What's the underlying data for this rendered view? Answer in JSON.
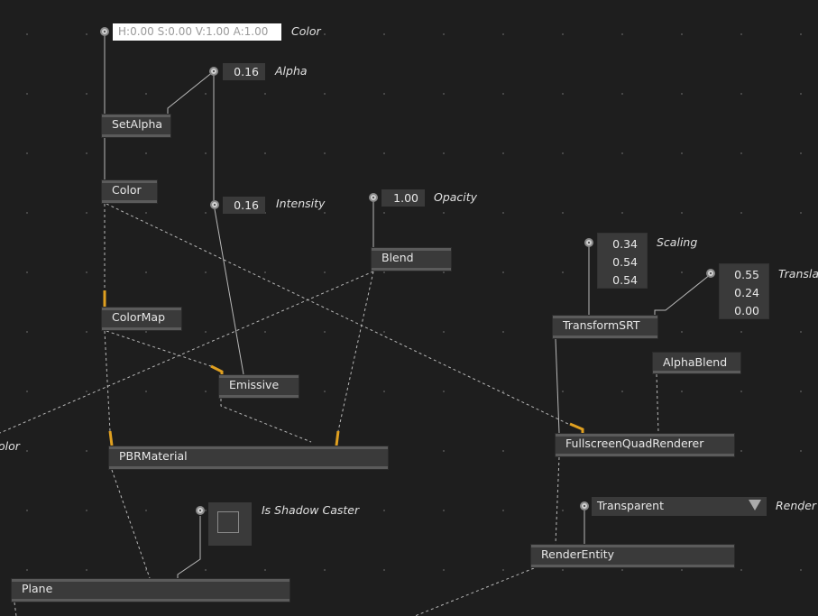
{
  "params": {
    "color": {
      "value": "H:0.00 S:0.00 V:1.00 A:1.00",
      "label": "Color"
    },
    "alpha": {
      "value": "0.16",
      "label": "Alpha"
    },
    "intensity": {
      "value": "0.16",
      "label": "Intensity"
    },
    "opacity": {
      "value": "1.00",
      "label": "Opacity"
    },
    "scaling": {
      "values": [
        "0.34",
        "0.54",
        "0.54"
      ],
      "label": "Scaling"
    },
    "translation": {
      "values": [
        "0.55",
        "0.24",
        "0.00"
      ],
      "label": "Transla"
    },
    "shadow": {
      "label": "Is Shadow Caster"
    },
    "render": {
      "value": "Transparent",
      "label": "Render"
    },
    "left_cut_label": "olor"
  },
  "nodes": {
    "set_alpha": "SetAlpha",
    "color": "Color",
    "colormap": "ColorMap",
    "blend": "Blend",
    "emissive": "Emissive",
    "pbr_material": "PBRMaterial",
    "plane": "Plane",
    "transform_srt": "TransformSRT",
    "alpha_blend": "AlphaBlend",
    "fullscreen_quad_renderer": "FullscreenQuadRenderer",
    "render_entity": "RenderEntity"
  },
  "colors": {
    "background": "#1e1e1e",
    "node": "#3a3a3a",
    "wire": "#b8b8b8",
    "active_input": "#e0a020"
  },
  "icons": {
    "pin": "parameter-pin-icon",
    "dropdown": "triangle-down-icon"
  }
}
